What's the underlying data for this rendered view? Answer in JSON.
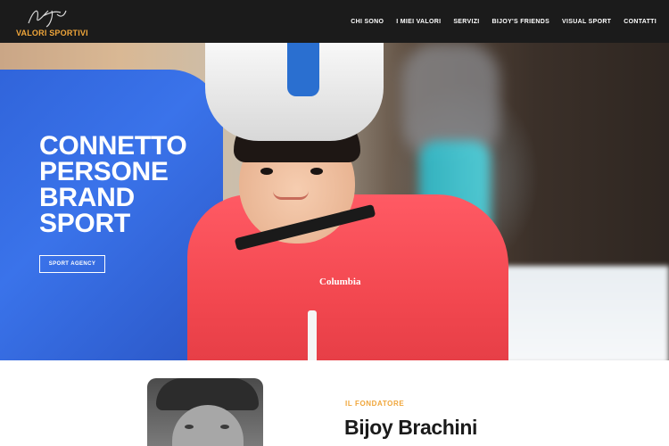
{
  "header": {
    "logo_text": "VALORI SPORTIVI",
    "nav": [
      "CHI SONO",
      "I MIEI VALORI",
      "SERVIZI",
      "BIJOY'S FRIENDS",
      "VISUAL SPORT",
      "CONTATTI"
    ]
  },
  "hero": {
    "title_lines": [
      "CONNETTO",
      "PERSONE",
      "BRAND",
      "SPORT"
    ],
    "button_label": "SPORT AGENCY",
    "jacket_brand": "Columbia"
  },
  "founder": {
    "kicker": "IL FONDATORE",
    "name": "Bijoy Brachini"
  },
  "colors": {
    "header_bg": "#1b1b1b",
    "accent": "#f0a63a",
    "text_dark": "#1b1b1b"
  }
}
